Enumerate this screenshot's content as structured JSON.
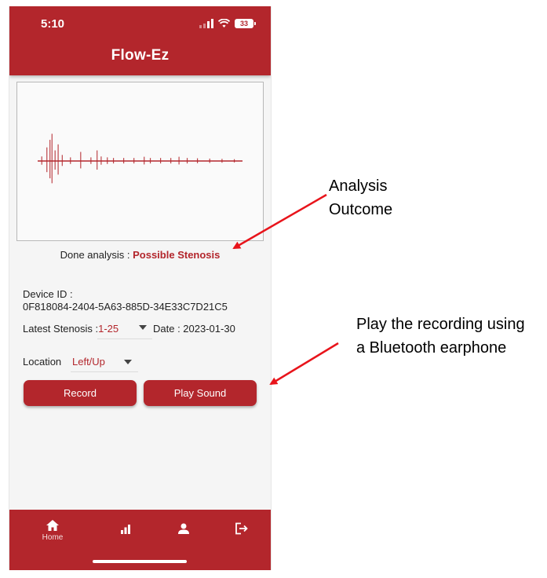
{
  "status_bar": {
    "time": "5:10",
    "battery": "33"
  },
  "header": {
    "title": "Flow-Ez"
  },
  "analysis": {
    "label": "Done analysis : ",
    "outcome": "Possible Stenosis"
  },
  "device": {
    "label": "Device ID :",
    "id": "0F818084-2404-5A63-885D-34E33C7D21C5"
  },
  "stenosis": {
    "label": "Latest Stenosis :",
    "value": "1-25"
  },
  "date": {
    "label": "Date : ",
    "value": "2023-01-30"
  },
  "location": {
    "label": "Location",
    "value": "Left/Up"
  },
  "buttons": {
    "record": "Record",
    "play": "Play Sound"
  },
  "bottom_nav": {
    "home": {
      "label": "Home",
      "icon": "home-icon"
    },
    "stats": {
      "icon": "bar-chart-icon"
    },
    "profile": {
      "icon": "person-icon"
    },
    "logout": {
      "icon": "logout-icon"
    }
  },
  "annotations": {
    "outcome_line1": "Analysis",
    "outcome_line2": "Outcome",
    "play_line1": "Play the recording using",
    "play_line2": "a Bluetooth earphone"
  },
  "colors": {
    "brand": "#b3262c",
    "waveform": "#b3262c",
    "annotation_arrow": "#e8141b"
  },
  "waveform": {
    "spikes": [
      {
        "t": 0.02,
        "a": 0.15
      },
      {
        "t": 0.045,
        "a": 0.45
      },
      {
        "t": 0.06,
        "a": 0.7
      },
      {
        "t": 0.07,
        "a": 0.9
      },
      {
        "t": 0.085,
        "a": 0.35
      },
      {
        "t": 0.1,
        "a": 0.55
      },
      {
        "t": 0.12,
        "a": 0.2
      },
      {
        "t": 0.16,
        "a": 0.12
      },
      {
        "t": 0.21,
        "a": 0.3
      },
      {
        "t": 0.26,
        "a": 0.12
      },
      {
        "t": 0.29,
        "a": 0.35
      },
      {
        "t": 0.31,
        "a": 0.15
      },
      {
        "t": 0.34,
        "a": 0.12
      },
      {
        "t": 0.37,
        "a": 0.1
      },
      {
        "t": 0.42,
        "a": 0.1
      },
      {
        "t": 0.47,
        "a": 0.1
      },
      {
        "t": 0.52,
        "a": 0.14
      },
      {
        "t": 0.55,
        "a": 0.1
      },
      {
        "t": 0.6,
        "a": 0.1
      },
      {
        "t": 0.65,
        "a": 0.1
      },
      {
        "t": 0.69,
        "a": 0.14
      },
      {
        "t": 0.73,
        "a": 0.1
      },
      {
        "t": 0.78,
        "a": 0.09
      },
      {
        "t": 0.84,
        "a": 0.08
      },
      {
        "t": 0.9,
        "a": 0.07
      },
      {
        "t": 0.96,
        "a": 0.06
      }
    ]
  }
}
